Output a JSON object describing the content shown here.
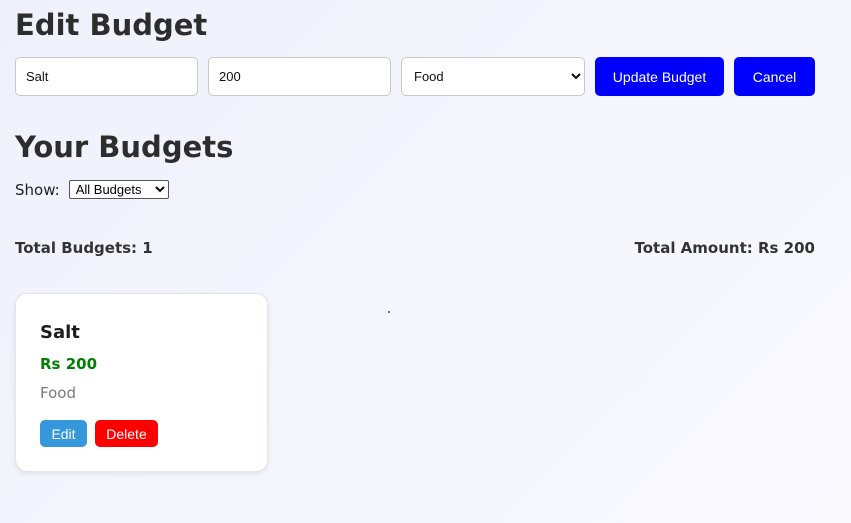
{
  "edit_form": {
    "title": "Edit Budget",
    "name_value": "Salt",
    "amount_value": "200",
    "category_selected": "Food",
    "update_label": "Update Budget",
    "cancel_label": "Cancel"
  },
  "budgets_section": {
    "title": "Your Budgets",
    "show_label": "Show:",
    "filter_selected": "All Budgets",
    "total_budgets": "Total Budgets: 1",
    "total_amount": "Total Amount: Rs 200"
  },
  "cards": [
    {
      "name": "Salt",
      "amount": "Rs 200",
      "category": "Food",
      "edit_label": "Edit",
      "delete_label": "Delete"
    }
  ],
  "colors": {
    "primary_button": "#0000ff",
    "edit_button": "#3498db",
    "delete_button": "#ff0000",
    "amount_text": "#008000"
  }
}
